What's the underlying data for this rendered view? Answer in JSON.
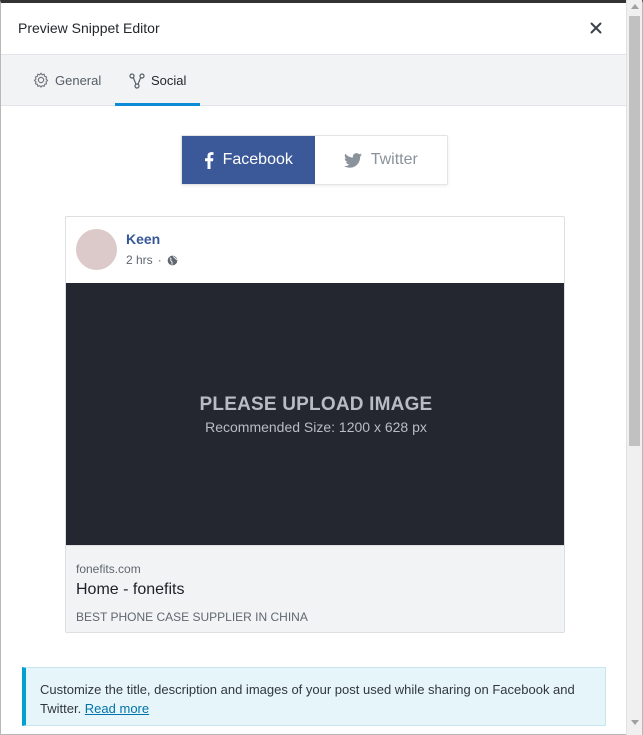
{
  "modal": {
    "title": "Preview Snippet Editor",
    "close_icon": "close-icon"
  },
  "tabs": [
    {
      "label": "General",
      "icon": "gear-icon",
      "active": false
    },
    {
      "label": "Social",
      "icon": "share-icon",
      "active": true
    }
  ],
  "network_switch": {
    "facebook_label": "Facebook",
    "twitter_label": "Twitter",
    "selected": "Facebook",
    "colors": {
      "facebook": "#3b5998",
      "twitter_text": "#8a939b"
    }
  },
  "facebook_preview": {
    "author_name": "Keen",
    "post_time": "2 hrs",
    "separator": "·",
    "visibility_icon": "globe-icon",
    "image_placeholder_title": "PLEASE UPLOAD IMAGE",
    "image_placeholder_subtitle": "Recommended Size: 1200 x 628 px",
    "domain": "fonefits.com",
    "post_title": "Home - fonefits",
    "post_description": "BEST PHONE CASE SUPPLIER IN CHINA"
  },
  "notice": {
    "text": "Customize the title, description and images of your post used while sharing on Facebook and Twitter.",
    "link_label": "Read more"
  },
  "colors": {
    "accent": "#0c8bd6",
    "notice_border": "#00a0d2",
    "author_link": "#365899"
  }
}
